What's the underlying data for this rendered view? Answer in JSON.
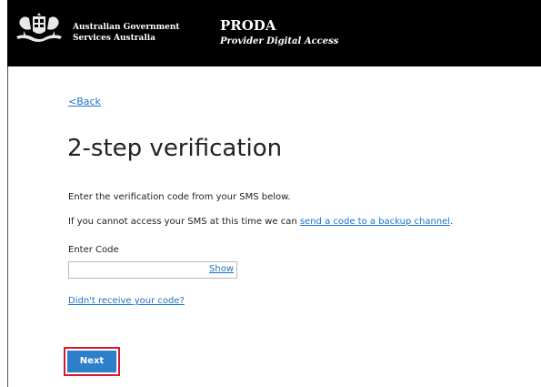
{
  "header": {
    "gov_line1": "Australian Government",
    "gov_line2": "Services Australia",
    "app_title": "PRODA",
    "app_subtitle": "Provider Digital Access",
    "crest_icon": "coat-of-arms-icon"
  },
  "nav": {
    "back_label": "<Back"
  },
  "page": {
    "title": "2-step verification"
  },
  "instructions": {
    "line1": "Enter the verification code from your SMS below.",
    "line2_prefix": "If you cannot access your SMS at this time we can ",
    "line2_link": "send a code to a backup channel",
    "line2_suffix": "."
  },
  "code_field": {
    "label": "Enter Code",
    "value": "",
    "show_label": "Show"
  },
  "resend_link": "Didn't receive your code?",
  "actions": {
    "next_label": "Next"
  },
  "colors": {
    "header_bg": "#000000",
    "link": "#1a73c8",
    "primary_button": "#2e7fc9",
    "highlight_border": "#d9182d"
  }
}
